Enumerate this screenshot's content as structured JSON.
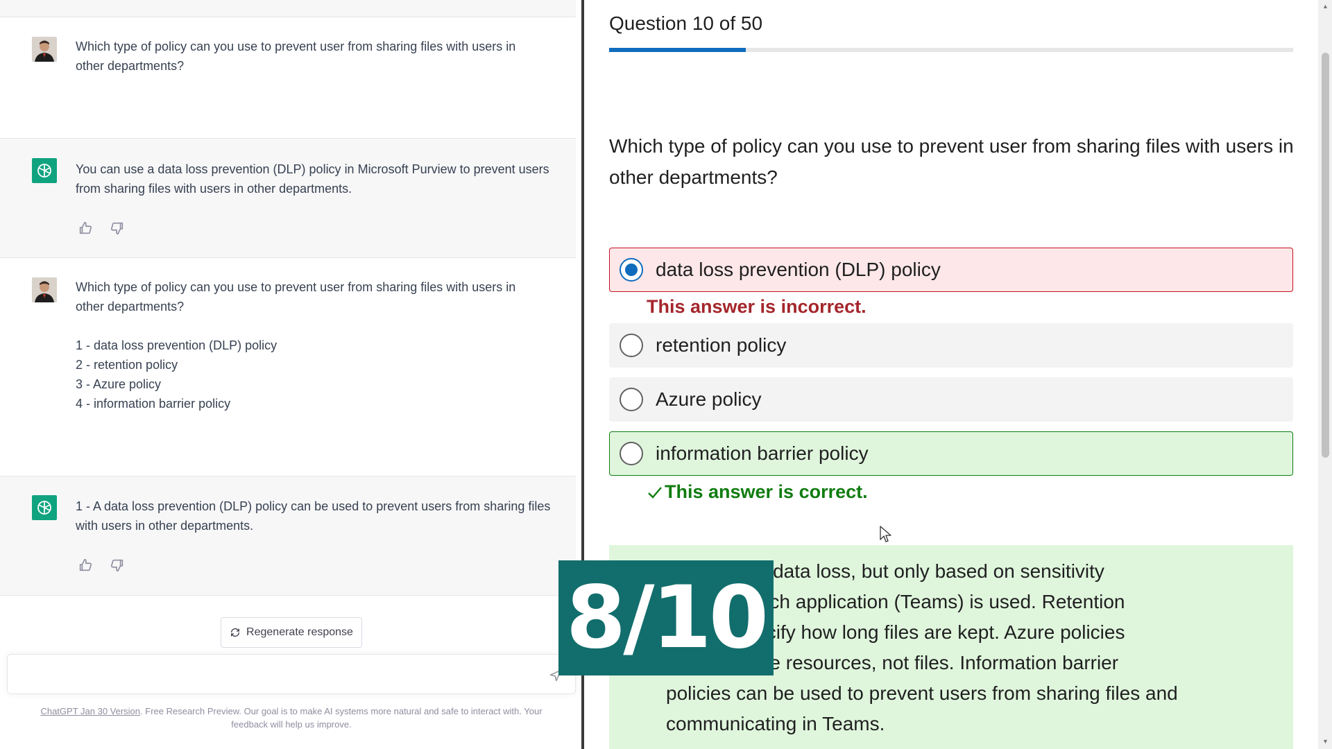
{
  "chat": {
    "messages": [
      {
        "role": "user",
        "text": "Which type of policy can you use to prevent user from sharing files with users in other departments?"
      },
      {
        "role": "assistant",
        "text": "You can use a data loss prevention (DLP) policy in Microsoft Purview to prevent users from sharing files with users in other departments."
      },
      {
        "role": "user",
        "text": "Which type of policy can you use to prevent user from sharing files with users in other departments?",
        "list": [
          "1 - data loss prevention (DLP) policy",
          "2 - retention policy",
          "3 - Azure policy",
          "4 - information barrier policy"
        ]
      },
      {
        "role": "assistant",
        "text": "1 - A data loss prevention (DLP) policy can be used to prevent users from sharing files with users in other departments."
      }
    ],
    "regenerate_label": "Regenerate response",
    "input_placeholder": "",
    "footer": {
      "version_link": "ChatGPT Jan 30 Version",
      "note": ". Free Research Preview. Our goal is to make AI systems more natural and safe to interact with. Your feedback will help us improve."
    }
  },
  "quiz": {
    "counter": "Question 10 of 50",
    "progress": 0.2,
    "question": "Which type of policy can you use to prevent user from sharing files with users in other departments?",
    "options": [
      {
        "label": "data loss prevention (DLP) policy",
        "state": "selected-incorrect"
      },
      {
        "label": "retention policy",
        "state": "none"
      },
      {
        "label": "Azure policy",
        "state": "none"
      },
      {
        "label": "information barrier policy",
        "state": "correct"
      }
    ],
    "feedback_incorrect": "This answer is incorrect.",
    "feedback_correct": "This answer is correct.",
    "explanation": "can prevent data loss, but only based on sensitivity ased on which application (Teams) is used. Retention used to specify how long files are kept. Azure policies govern Azure resources, not files. Information barrier policies can be used to prevent users from sharing files and communicating in Teams.",
    "explanation_lines": [
      "can prevent data loss, but only based on sensitivity",
      "ased on which application (Teams) is used. Retention",
      "used to specify how long files are kept. Azure policies",
      "govern Azure resources, not files. Information barrier",
      "policies can be used to prevent users from sharing files and",
      "communicating in Teams."
    ]
  },
  "overlay": {
    "score": "8/10"
  },
  "colors": {
    "accent": "#0f6cbd",
    "incorrect": "#a4262c",
    "correct": "#107c10",
    "score_bg": "#126e6c",
    "chatgpt_green": "#10a37f"
  },
  "icons": [
    "user-avatar",
    "chatgpt-logo-icon",
    "thumbs-up-icon",
    "thumbs-down-icon",
    "regenerate-icon",
    "send-icon",
    "checkmark-icon",
    "mouse-cursor-icon"
  ]
}
